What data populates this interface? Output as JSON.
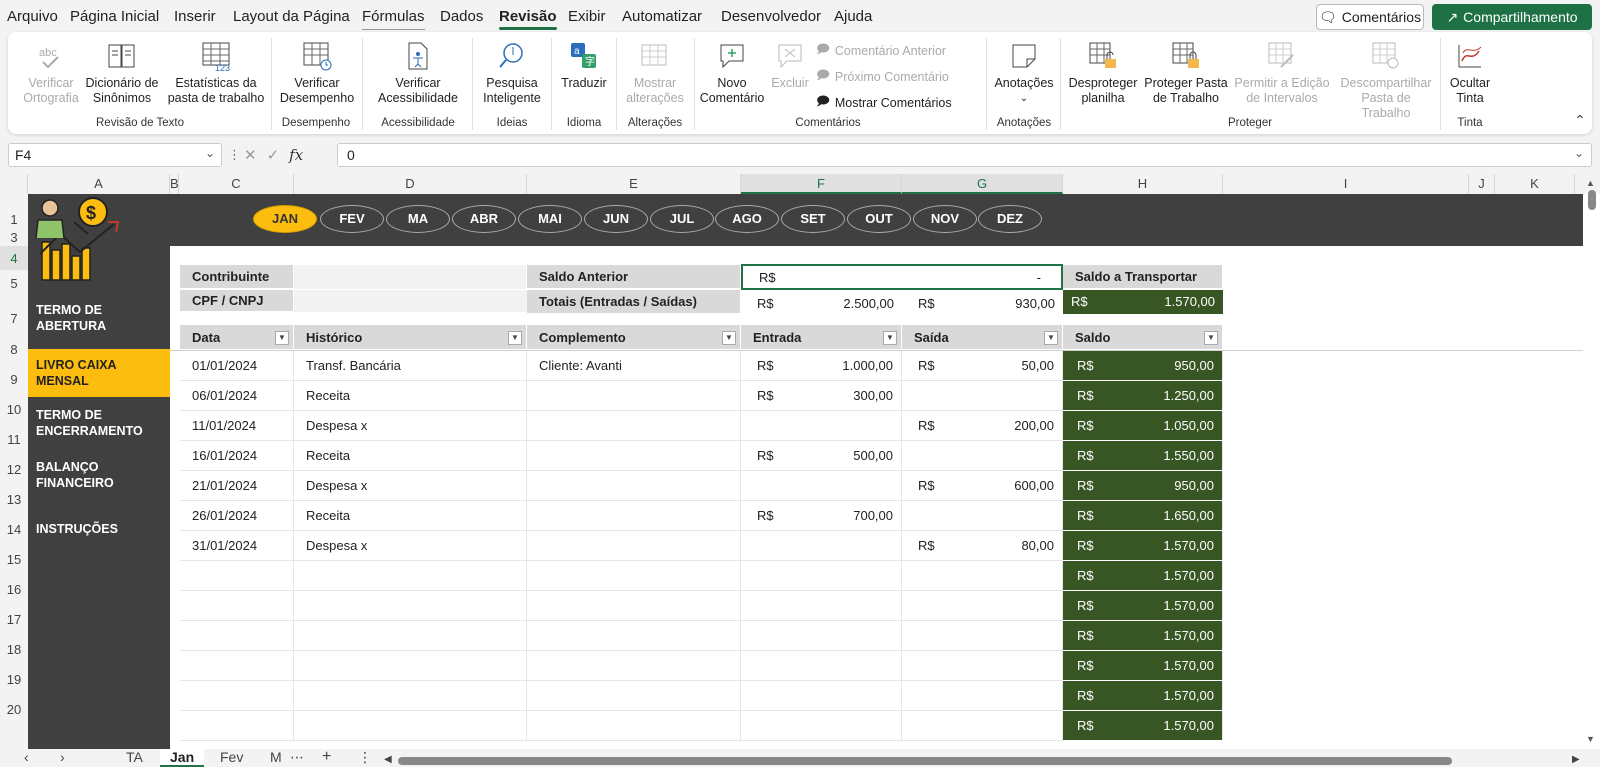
{
  "menu": {
    "items": [
      "Arquivo",
      "Página Inicial",
      "Inserir",
      "Layout da Página",
      "Fórmulas",
      "Dados",
      "Revisão",
      "Exibir",
      "Automatizar",
      "Desenvolvedor",
      "Ajuda"
    ],
    "comments_label": "Comentários",
    "share_label": "Compartilhamento"
  },
  "ribbon": {
    "check_spelling": "Verificar Ortografia",
    "thesaurus": "Dicionário de Sinônimos",
    "workbook_stats": "Estatísticas da pasta de trabalho",
    "group_revision": "Revisão de Texto",
    "check_performance": "Verificar Desempenho",
    "group_performance": "Desempenho",
    "check_accessibility": "Verificar Acessibilidade",
    "group_accessibility": "Acessibilidade",
    "smart_lookup": "Pesquisa Inteligente",
    "group_ideas": "Ideias",
    "translate": "Traduzir",
    "group_language": "Idioma",
    "show_changes": "Mostrar alterações",
    "group_changes": "Alterações",
    "new_comment": "Novo Comentário",
    "delete": "Excluir",
    "prev_comment": "Comentário Anterior",
    "next_comment": "Próximo Comentário",
    "show_comments": "Mostrar Comentários",
    "group_comments": "Comentários",
    "notes": "Anotações",
    "group_notes": "Anotações",
    "unprotect_sheet": "Desproteger planilha",
    "protect_workbook": "Proteger Pasta de Trabalho",
    "allow_edit_ranges": "Permitir a Edição de Intervalos",
    "unshare_workbook": "Descompartilhar Pasta de Trabalho",
    "group_protect": "Proteger",
    "hide_ink": "Ocultar Tinta",
    "group_ink": "Tinta"
  },
  "formula_bar": {
    "name_box": "F4",
    "value": "0",
    "fx": "fx"
  },
  "columns": [
    "A",
    "B",
    "C",
    "D",
    "E",
    "F",
    "G",
    "H",
    "I",
    "J",
    "K"
  ],
  "rows": [
    "1",
    "3",
    "4",
    "5",
    "7",
    "8",
    "9",
    "10",
    "11",
    "12",
    "13",
    "14",
    "15",
    "16",
    "17",
    "18",
    "19",
    "20"
  ],
  "months": [
    "JAN",
    "FEV",
    "MA",
    "ABR",
    "MAI",
    "JUN",
    "JUL",
    "AGO",
    "SET",
    "OUT",
    "NOV",
    "DEZ"
  ],
  "nav": [
    "TERMO DE ABERTURA",
    "LIVRO CAIXA MENSAL",
    "TERMO DE ENCERRAMENTO",
    "BALANÇO FINANCEIRO",
    "INSTRUÇÕES"
  ],
  "summary": {
    "contribuinte_label": "Contribuinte",
    "cpf_label": "CPF / CNPJ",
    "saldo_anterior_label": "Saldo Anterior",
    "totais_label": "Totais (Entradas / Saídas)",
    "currency": "R$",
    "saldo_anterior_value": "-",
    "total_entradas": "2.500,00",
    "total_saidas": "930,00",
    "saldo_transportar_label": "Saldo a Transportar",
    "saldo_transportar_value": "1.570,00"
  },
  "table": {
    "headers": [
      "Data",
      "Histórico",
      "Complemento",
      "Entrada",
      "Saída",
      "Saldo"
    ],
    "rows": [
      {
        "data": "01/01/2024",
        "historico": "Transf. Bancária",
        "complemento": "Cliente: Avanti",
        "entrada": "1.000,00",
        "saida": "50,00",
        "saldo": "950,00"
      },
      {
        "data": "06/01/2024",
        "historico": "Receita",
        "complemento": "",
        "entrada": "300,00",
        "saida": "",
        "saldo": "1.250,00"
      },
      {
        "data": "11/01/2024",
        "historico": "Despesa x",
        "complemento": "",
        "entrada": "",
        "saida": "200,00",
        "saldo": "1.050,00"
      },
      {
        "data": "16/01/2024",
        "historico": "Receita",
        "complemento": "",
        "entrada": "500,00",
        "saida": "",
        "saldo": "1.550,00"
      },
      {
        "data": "21/01/2024",
        "historico": "Despesa x",
        "complemento": "",
        "entrada": "",
        "saida": "600,00",
        "saldo": "950,00"
      },
      {
        "data": "26/01/2024",
        "historico": "Receita",
        "complemento": "",
        "entrada": "700,00",
        "saida": "",
        "saldo": "1.650,00"
      },
      {
        "data": "31/01/2024",
        "historico": "Despesa x",
        "complemento": "",
        "entrada": "",
        "saida": "80,00",
        "saldo": "1.570,00"
      },
      {
        "data": "",
        "historico": "",
        "complemento": "",
        "entrada": "",
        "saida": "",
        "saldo": "1.570,00"
      },
      {
        "data": "",
        "historico": "",
        "complemento": "",
        "entrada": "",
        "saida": "",
        "saldo": "1.570,00"
      },
      {
        "data": "",
        "historico": "",
        "complemento": "",
        "entrada": "",
        "saida": "",
        "saldo": "1.570,00"
      },
      {
        "data": "",
        "historico": "",
        "complemento": "",
        "entrada": "",
        "saida": "",
        "saldo": "1.570,00"
      },
      {
        "data": "",
        "historico": "",
        "complemento": "",
        "entrada": "",
        "saida": "",
        "saldo": "1.570,00"
      },
      {
        "data": "",
        "historico": "",
        "complemento": "",
        "entrada": "",
        "saida": "",
        "saldo": "1.570,00"
      }
    ]
  },
  "tabs": [
    "TA",
    "Jan",
    "Fev",
    "M"
  ],
  "colors": {
    "accent": "#217346",
    "dark": "#404040",
    "yellow": "#fcbd0f",
    "green_cell": "#375623",
    "header_gray": "#d9d9d9"
  }
}
